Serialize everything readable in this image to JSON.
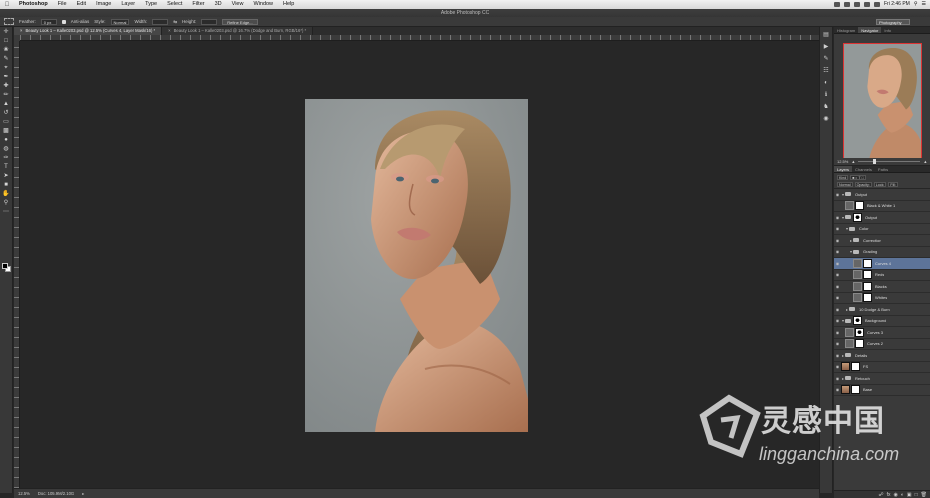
{
  "os_menubar": {
    "menus": [
      "Photoshop",
      "File",
      "Edit",
      "Image",
      "Layer",
      "Type",
      "Select",
      "Filter",
      "3D",
      "View",
      "Window",
      "Help"
    ],
    "clock": "Fri 2:46 PM"
  },
  "window": {
    "title": "Adobe Photoshop CC"
  },
  "options_bar": {
    "feather_label": "Feather:",
    "feather_value": "0 px",
    "antialias_label": "Anti-alias",
    "style_label": "Style:",
    "style_value": "Normal",
    "width_label": "Width:",
    "height_label": "Height:",
    "refine_button": "Refine Edge...",
    "workspace": "Photography"
  },
  "doc_tabs": [
    {
      "label": "Beauty Look 1 – Kalle0203.psd @ 12.5% (Curves 4, Layer Mask/16) *",
      "active": true
    },
    {
      "label": "Beauty Look 1 – Kalle0203.psd @ 16.7% (Dodge and Burn, RGB/16*) *",
      "active": false
    }
  ],
  "status_bar": {
    "zoom": "12.5%",
    "doc": "Doc: 105.9M/2.10G"
  },
  "panels": {
    "top_tabs": [
      "Histogram",
      "Navigator",
      "Info"
    ],
    "top_active": 1,
    "nav_zoom": "12.5%",
    "nav_zoom_level": 0.24,
    "layer_tabs": [
      "Layers",
      "Channels",
      "Paths"
    ],
    "layer_active": 0,
    "kind_label": "Kind",
    "blend_mode": "Normal",
    "opacity_label": "Opacity:",
    "lock_label": "Lock:",
    "fill_label": "Fill:"
  },
  "layers": [
    {
      "name": "Output",
      "type": "folder",
      "indent": 0,
      "expanded": true,
      "eye": true
    },
    {
      "name": "Black & White 1",
      "type": "adj",
      "indent": 1,
      "eye": false
    },
    {
      "name": "Output",
      "type": "folder-mask",
      "indent": 0,
      "expanded": true,
      "eye": true
    },
    {
      "name": "Color",
      "type": "folder",
      "indent": 1,
      "expanded": true,
      "eye": true
    },
    {
      "name": "Correction",
      "type": "folder",
      "indent": 2,
      "expanded": false,
      "eye": true
    },
    {
      "name": "Grading",
      "type": "folder",
      "indent": 2,
      "expanded": true,
      "eye": true
    },
    {
      "name": "Curves 4",
      "type": "adj",
      "indent": 3,
      "eye": true,
      "selected": true
    },
    {
      "name": "Reds",
      "type": "adj",
      "indent": 3,
      "eye": true
    },
    {
      "name": "Blacks",
      "type": "adj",
      "indent": 3,
      "eye": true
    },
    {
      "name": "Whites",
      "type": "adj",
      "indent": 3,
      "eye": true
    },
    {
      "name": "10 Dodge & Burn",
      "type": "folder",
      "indent": 1,
      "expanded": false,
      "eye": true
    },
    {
      "name": "Background",
      "type": "folder-mask",
      "indent": 0,
      "expanded": true,
      "eye": true
    },
    {
      "name": "Curves 3",
      "type": "adj-dark",
      "indent": 1,
      "eye": true
    },
    {
      "name": "Curves 2",
      "type": "adj",
      "indent": 1,
      "eye": true
    },
    {
      "name": "Details",
      "type": "folder",
      "indent": 0,
      "expanded": false,
      "eye": true
    },
    {
      "name": "FS",
      "type": "photo",
      "indent": 0,
      "eye": true
    },
    {
      "name": "Retouch",
      "type": "folder",
      "indent": 0,
      "expanded": false,
      "eye": true
    },
    {
      "name": "Base",
      "type": "photo",
      "indent": 0,
      "eye": true
    }
  ],
  "watermark": {
    "cn": "灵感中国",
    "en": "lingganchina.com"
  }
}
